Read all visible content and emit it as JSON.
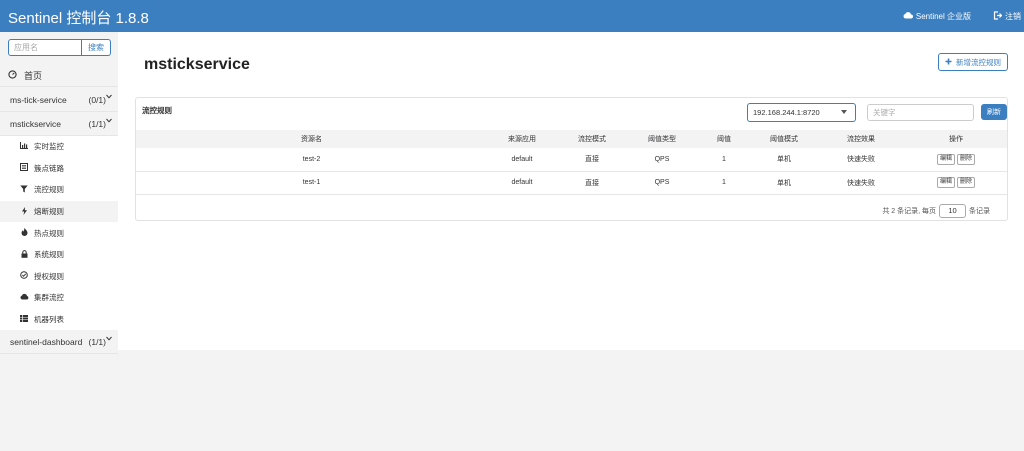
{
  "header": {
    "title": "Sentinel 控制台 1.8.8",
    "enterprise_label": "Sentinel 企业版",
    "logout_label": "注销"
  },
  "sidebar": {
    "search_placeholder": "应用名",
    "search_button": "搜索",
    "home_label": "首页",
    "apps": [
      {
        "name": "ms-tick-service",
        "count": "(0/1)"
      },
      {
        "name": "mstickservice",
        "count": "(1/1)"
      },
      {
        "name": "sentinel-dashboard",
        "count": "(1/1)"
      }
    ],
    "menu": [
      {
        "label": "实时监控",
        "icon": "bar-chart-icon"
      },
      {
        "label": "簇点链路",
        "icon": "list-icon"
      },
      {
        "label": "流控规则",
        "icon": "filter-icon"
      },
      {
        "label": "熔断规则",
        "icon": "flash-icon"
      },
      {
        "label": "热点规则",
        "icon": "fire-icon"
      },
      {
        "label": "系统规则",
        "icon": "lock-icon"
      },
      {
        "label": "授权规则",
        "icon": "check-circle-icon"
      },
      {
        "label": "集群流控",
        "icon": "cloud-icon"
      },
      {
        "label": "机器列表",
        "icon": "th-list-icon"
      }
    ]
  },
  "main": {
    "title": "mstickservice",
    "add_button": "新增流控规则",
    "panel_title": "流控规则",
    "machine_selected": "192.168.244.1:8720",
    "keyword_placeholder": "关键字",
    "refresh_button": "刷新",
    "table": {
      "headers": [
        "资源名",
        "来源应用",
        "流控模式",
        "阈值类型",
        "阈值",
        "阈值模式",
        "流控效果",
        "操作"
      ],
      "rows": [
        [
          "test-2",
          "default",
          "直接",
          "QPS",
          "1",
          "单机",
          "快速失败"
        ],
        [
          "test-1",
          "default",
          "直接",
          "QPS",
          "1",
          "单机",
          "快速失败"
        ]
      ],
      "edit_label": "编辑",
      "delete_label": "删除"
    },
    "pager": {
      "prefix": "共 2 条记录, 每页",
      "page_size": "10",
      "suffix": "条记录"
    }
  },
  "colors": {
    "brand": "#3b7fc0",
    "background": "#f3f3f4"
  }
}
